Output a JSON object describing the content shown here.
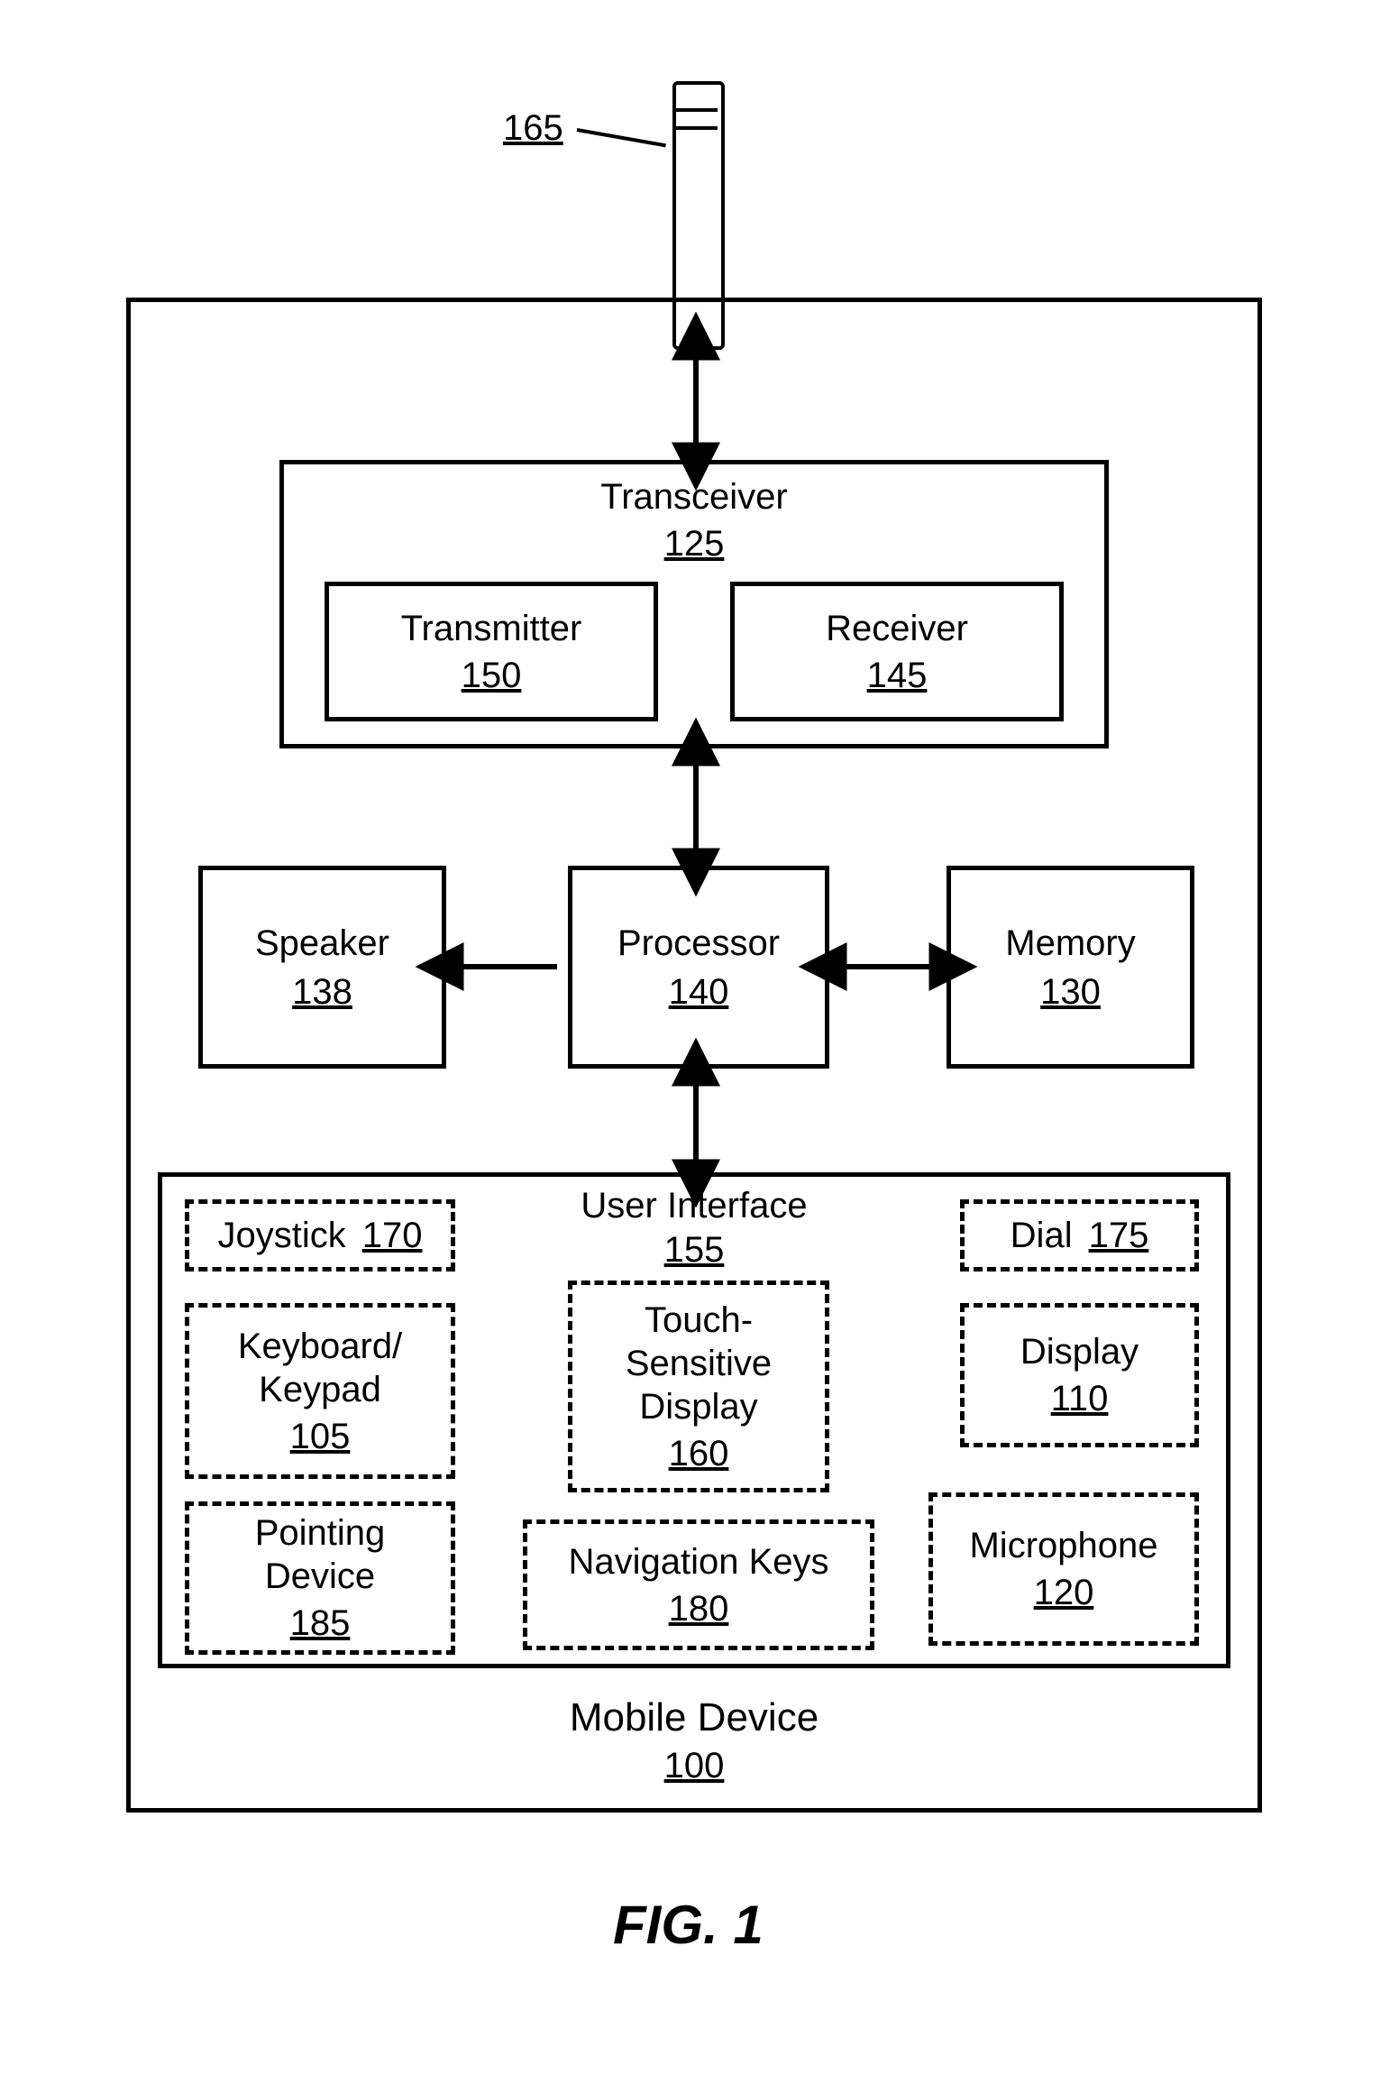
{
  "caption": "FIG. 1",
  "antenna_ref": "165",
  "mobile_device": {
    "label": "Mobile Device",
    "ref": "100"
  },
  "transceiver": {
    "label": "Transceiver",
    "ref": "125"
  },
  "transmitter": {
    "label": "Transmitter",
    "ref": "150"
  },
  "receiver": {
    "label": "Receiver",
    "ref": "145"
  },
  "speaker": {
    "label": "Speaker",
    "ref": "138"
  },
  "processor": {
    "label": "Processor",
    "ref": "140"
  },
  "memory": {
    "label": "Memory",
    "ref": "130"
  },
  "ui": {
    "label": "User Interface",
    "ref": "155"
  },
  "joystick": {
    "label": "Joystick",
    "ref": "170"
  },
  "dial": {
    "label": "Dial",
    "ref": "175"
  },
  "keyboard": {
    "label_l1": "Keyboard/",
    "label_l2": "Keypad",
    "ref": "105"
  },
  "touch": {
    "label_l1": "Touch-",
    "label_l2": "Sensitive",
    "label_l3": "Display",
    "ref": "160"
  },
  "display": {
    "label": "Display",
    "ref": "110"
  },
  "pointing": {
    "label_l1": "Pointing",
    "label_l2": "Device",
    "ref": "185"
  },
  "nav": {
    "label": "Navigation Keys",
    "ref": "180"
  },
  "mic": {
    "label": "Microphone",
    "ref": "120"
  }
}
